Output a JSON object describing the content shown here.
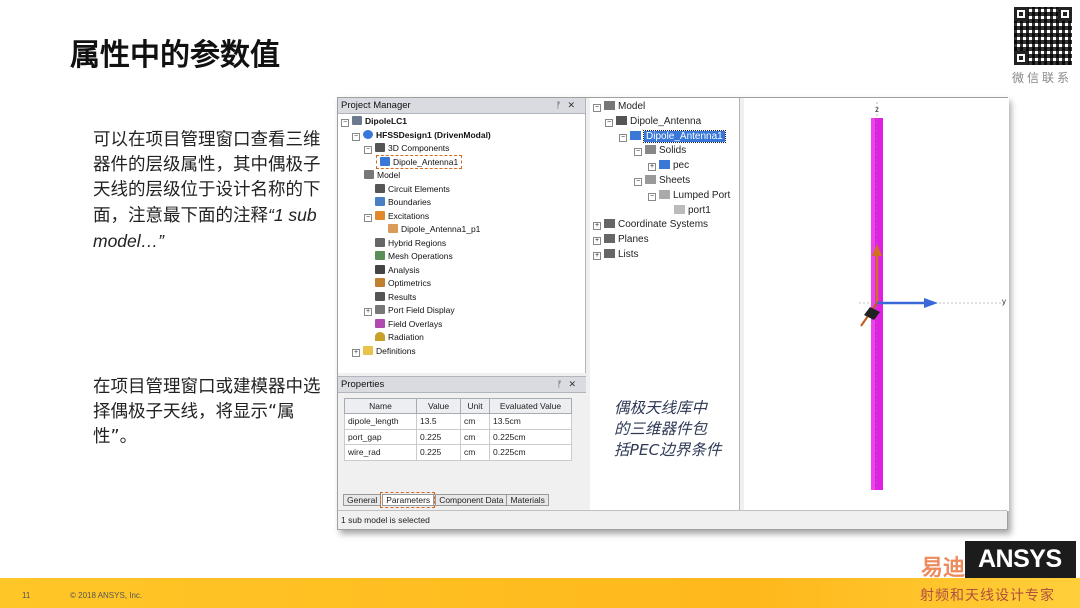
{
  "title": "属性中的参数值",
  "qr_label": "微信联系",
  "para1": {
    "text": "可以在项目管理窗口查看三维器件的层级属性，其中偶极子天线的层级位于设计名称的下面，注意最下面的注释",
    "quote": "“1 sub model…”"
  },
  "para2": "在项目管理窗口或建模器中选择偶极子天线，将显示“属性”。",
  "project_manager": {
    "title": "Project Manager",
    "header_buttons": "✕",
    "items": [
      {
        "label": "DipoleLC1"
      },
      {
        "label": "HFSSDesign1 (DrivenModal)"
      },
      {
        "label": "3D Components"
      },
      {
        "label": "Dipole_Antenna1"
      },
      {
        "label": "Model"
      },
      {
        "label": "Circuit Elements"
      },
      {
        "label": "Boundaries"
      },
      {
        "label": "Excitations"
      },
      {
        "label": "Dipole_Antenna1_p1"
      },
      {
        "label": "Hybrid Regions"
      },
      {
        "label": "Mesh Operations"
      },
      {
        "label": "Analysis"
      },
      {
        "label": "Optimetrics"
      },
      {
        "label": "Results"
      },
      {
        "label": "Port Field Display"
      },
      {
        "label": "Field Overlays"
      },
      {
        "label": "Radiation"
      },
      {
        "label": "Definitions"
      }
    ]
  },
  "properties": {
    "title": "Properties",
    "header_buttons": "✕",
    "columns": [
      "Name",
      "Value",
      "Unit",
      "Evaluated Value"
    ],
    "rows": [
      [
        "dipole_length",
        "13.5",
        "cm",
        "13.5cm"
      ],
      [
        "port_gap",
        "0.225",
        "cm",
        "0.225cm"
      ],
      [
        "wire_rad",
        "0.225",
        "cm",
        "0.225cm"
      ]
    ],
    "tabs": [
      "General",
      "Parameters",
      "Component Data",
      "Materials"
    ]
  },
  "status_text": "1 sub model is selected",
  "model_tree": {
    "items": [
      {
        "label": "Model"
      },
      {
        "label": "Dipole_Antenna"
      },
      {
        "label": "Dipole_Antenna1"
      },
      {
        "label": "Solids"
      },
      {
        "label": "pec"
      },
      {
        "label": "Sheets"
      },
      {
        "label": "Lumped Port"
      },
      {
        "label": "port1"
      },
      {
        "label": "Coordinate Systems"
      },
      {
        "label": "Planes"
      },
      {
        "label": "Lists"
      }
    ]
  },
  "note": [
    "偶极天线库中",
    "的三维器件包",
    "括PEC边界条件"
  ],
  "viewport": {
    "axis_z": "z",
    "axis_y": "y",
    "rod_color": "#e020e0"
  },
  "footer": {
    "page_number": "11",
    "copyright": "© 2018 ANSYS, Inc.",
    "logo": "ANSYS",
    "watermark_top": "易迪",
    "watermark_bottom": "射频和天线设计专家"
  },
  "colors": {
    "accent": "#ffb81c",
    "highlight_box": "#d46a1f",
    "selection": "#3876d8"
  }
}
